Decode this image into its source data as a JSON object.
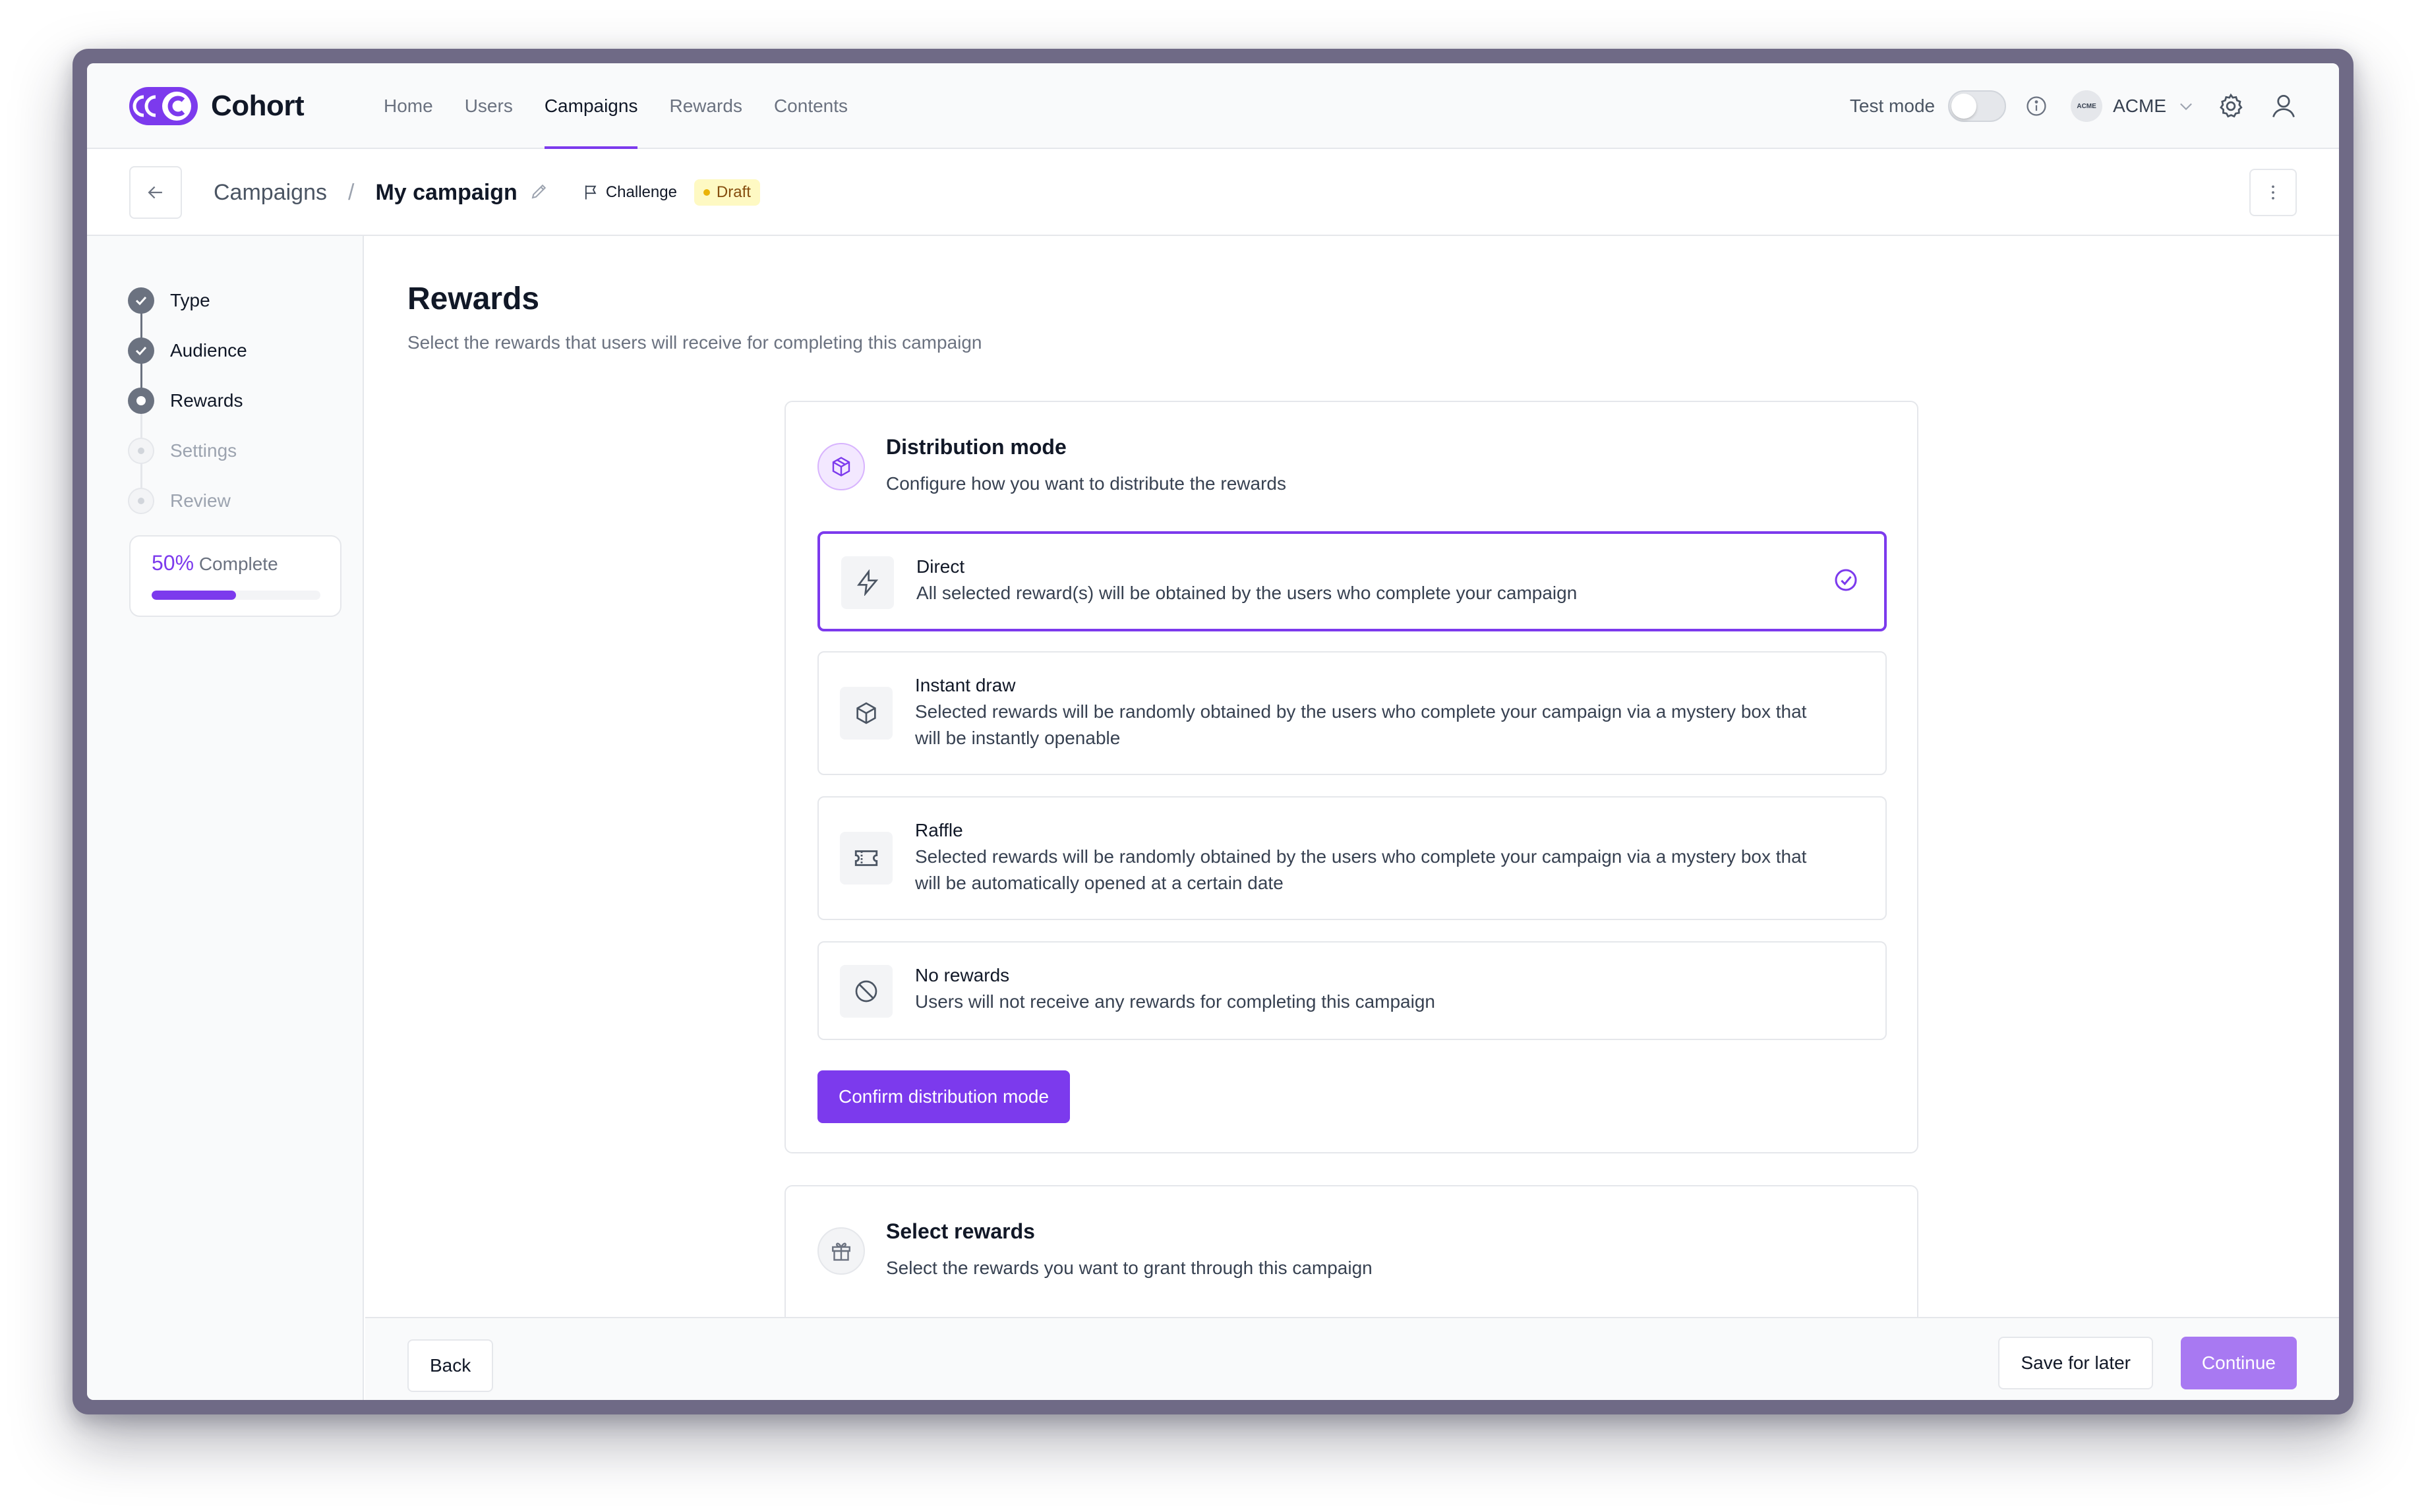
{
  "app": {
    "name": "Cohort"
  },
  "nav": {
    "links": [
      "Home",
      "Users",
      "Campaigns",
      "Rewards",
      "Contents"
    ],
    "active": "Campaigns",
    "test_mode_label": "Test mode",
    "test_mode_on": false,
    "org_logo_text": "ACME",
    "org_name": "ACME"
  },
  "breadcrumb": {
    "parent": "Campaigns",
    "separator": "/",
    "current": "My campaign",
    "type_chip": "Challenge",
    "status_badge": "Draft"
  },
  "steps": [
    {
      "label": "Type",
      "state": "done"
    },
    {
      "label": "Audience",
      "state": "done"
    },
    {
      "label": "Rewards",
      "state": "current"
    },
    {
      "label": "Settings",
      "state": "todo"
    },
    {
      "label": "Review",
      "state": "todo"
    }
  ],
  "progress": {
    "percent_label": "50%",
    "suffix": " Complete",
    "fraction": 0.5
  },
  "page": {
    "title": "Rewards",
    "subtitle": "Select the rewards that users will receive for completing this campaign"
  },
  "distribution": {
    "title": "Distribution mode",
    "subtitle": "Configure how you want to distribute the rewards",
    "options": [
      {
        "icon": "lightning-icon",
        "title": "Direct",
        "description": "All selected reward(s) will be obtained by the users who complete your campaign",
        "selected": true
      },
      {
        "icon": "box-icon",
        "title": "Instant draw",
        "description": "Selected rewards will be randomly obtained by the users who complete your campaign via a mystery box that will be instantly openable",
        "selected": false
      },
      {
        "icon": "ticket-icon",
        "title": "Raffle",
        "description": "Selected rewards will be randomly obtained by the users who complete your campaign via a mystery box that will be automatically opened at a certain date",
        "selected": false
      },
      {
        "icon": "ban-icon",
        "title": "No rewards",
        "description": "Users will not receive any rewards for completing this campaign",
        "selected": false
      }
    ],
    "confirm_label": "Confirm distribution mode"
  },
  "select_rewards": {
    "title": "Select rewards",
    "subtitle": "Select the rewards you want to grant through this campaign"
  },
  "footer": {
    "back_label": "Back",
    "save_label": "Save for later",
    "continue_label": "Continue"
  },
  "colors": {
    "accent": "#7c3aed",
    "accent_disabled": "#a879f2",
    "draft_bg": "#fef9c3"
  }
}
